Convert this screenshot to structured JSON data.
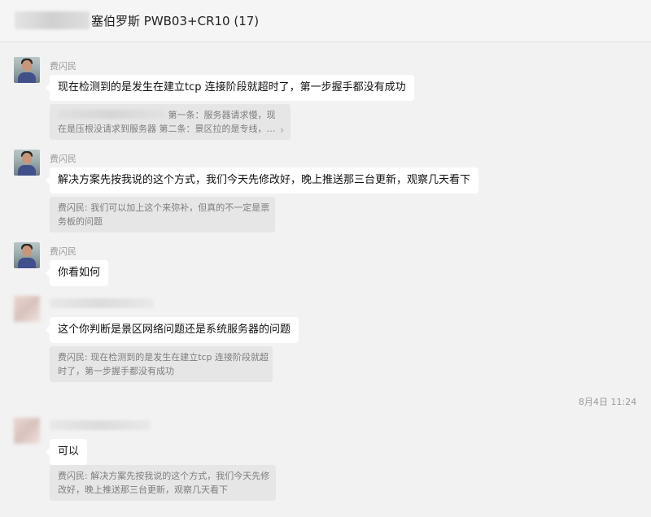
{
  "window": {
    "title": "塞伯罗斯 PWB03+CR10 (17)"
  },
  "messages": [
    {
      "sender": "费闪民",
      "text": "现在检测到的是发生在建立tcp 连接阶段就超时了，第一步握手都没有成功",
      "quote_lines": [
        "第一条：服务器请求慢，现",
        "在是压根没请求到服务器 第二条：景区拉的是专线，…"
      ]
    },
    {
      "sender": "费闪民",
      "text": "解决方案先按我说的这个方式，我们今天先修改好，晚上推送那三台更新，观察几天看下",
      "quote_lines": [
        "费闪民: 我们可以加上这个来弥补，但真的不一定是票",
        "务板的问题"
      ]
    },
    {
      "sender": "费闪民",
      "text": "你看如何"
    },
    {
      "text": "这个你判断是景区网络问题还是系统服务器的问题",
      "quote_lines": [
        "费闪民: 现在检测到的是发生在建立tcp 连接阶段就超",
        "时了，第一步握手都没有成功"
      ]
    },
    {
      "text": "可以",
      "quote_lines": [
        "费闪民: 解决方案先按我说的这个方式，我们今天先修",
        "改好，晚上推送那三台更新，观察几天看下"
      ]
    }
  ],
  "timestamp": "8月4日 11:24",
  "icons": {
    "quote_expand": "chevron-right-icon"
  }
}
